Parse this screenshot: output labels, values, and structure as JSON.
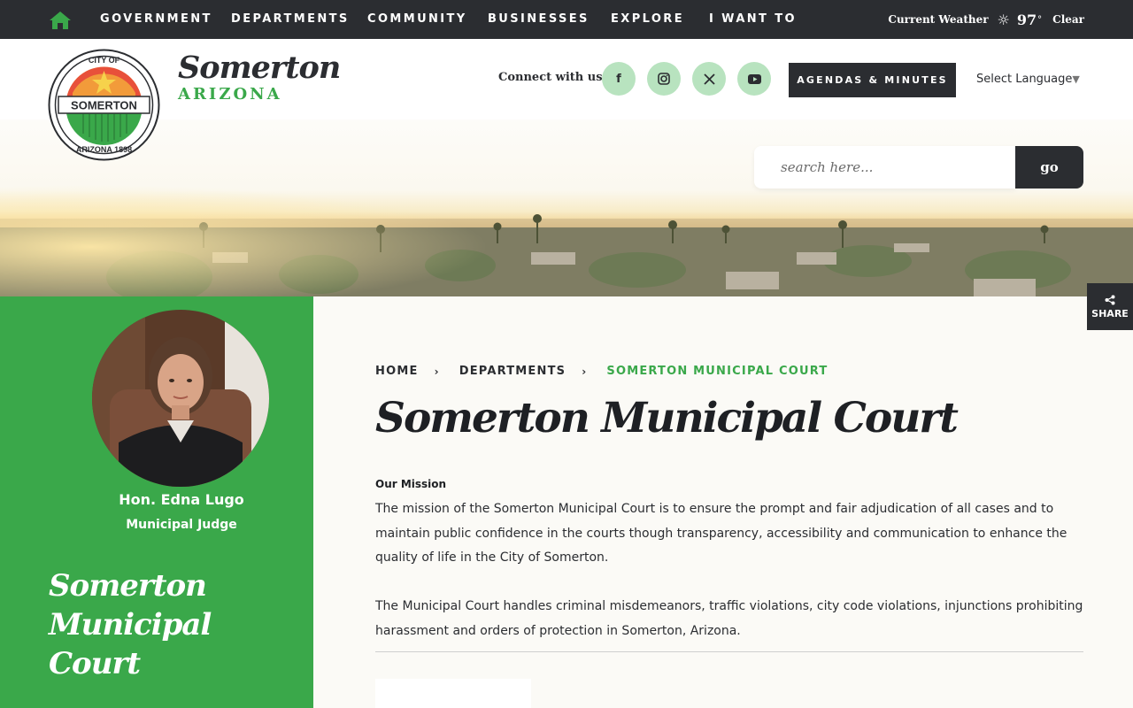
{
  "nav": {
    "items": [
      "GOVERNMENT",
      "DEPARTMENTS",
      "COMMUNITY",
      "BUSINESSES",
      "EXPLORE",
      "I WANT TO"
    ],
    "home_icon": "home-icon"
  },
  "weather": {
    "label": "Current Weather",
    "icon": "sun-icon",
    "temp": "97",
    "deg": "°",
    "condition": "Clear"
  },
  "brand": {
    "name": "Somerton",
    "state": "ARIZONA",
    "seal_top": "CITY OF",
    "seal_middle": "SOMERTON",
    "seal_bottom": "ARIZONA 1898"
  },
  "social": {
    "label": "Connect with us",
    "icons": [
      "facebook-icon",
      "instagram-icon",
      "x-icon",
      "youtube-icon"
    ]
  },
  "header": {
    "agendas_label": "AGENDAS & MINUTES",
    "language_label": "Select Language",
    "language_caret": "▼"
  },
  "search": {
    "placeholder": "search here...",
    "go_label": "go"
  },
  "share": {
    "label": "SHARE"
  },
  "sidebar": {
    "judge_name": "Hon. Edna Lugo",
    "judge_title": "Municipal Judge",
    "heading_line1": "Somerton",
    "heading_line2": "Municipal",
    "heading_line3": "Court"
  },
  "breadcrumb": {
    "home": "HOME",
    "departments": "DEPARTMENTS",
    "current": "SOMERTON MUNICIPAL COURT",
    "separator": "›"
  },
  "main": {
    "title": "Somerton Municipal Court",
    "mission_label": "Our Mission",
    "mission_text": "The mission of the Somerton Municipal Court is to ensure the prompt and fair adjudication of all cases and to maintain public confidence in the courts though transparency, accessibility and communication to enhance the quality of life in the City of Somerton.",
    "court_text": "The Municipal Court handles criminal misdemeanors, traffic violations, city code violations, injunctions prohibiting harassment and orders of protection in Somerton, Arizona."
  },
  "colors": {
    "green": "#3aa84a",
    "dark": "#2b2d31",
    "light_green": "#b8e3bf"
  }
}
